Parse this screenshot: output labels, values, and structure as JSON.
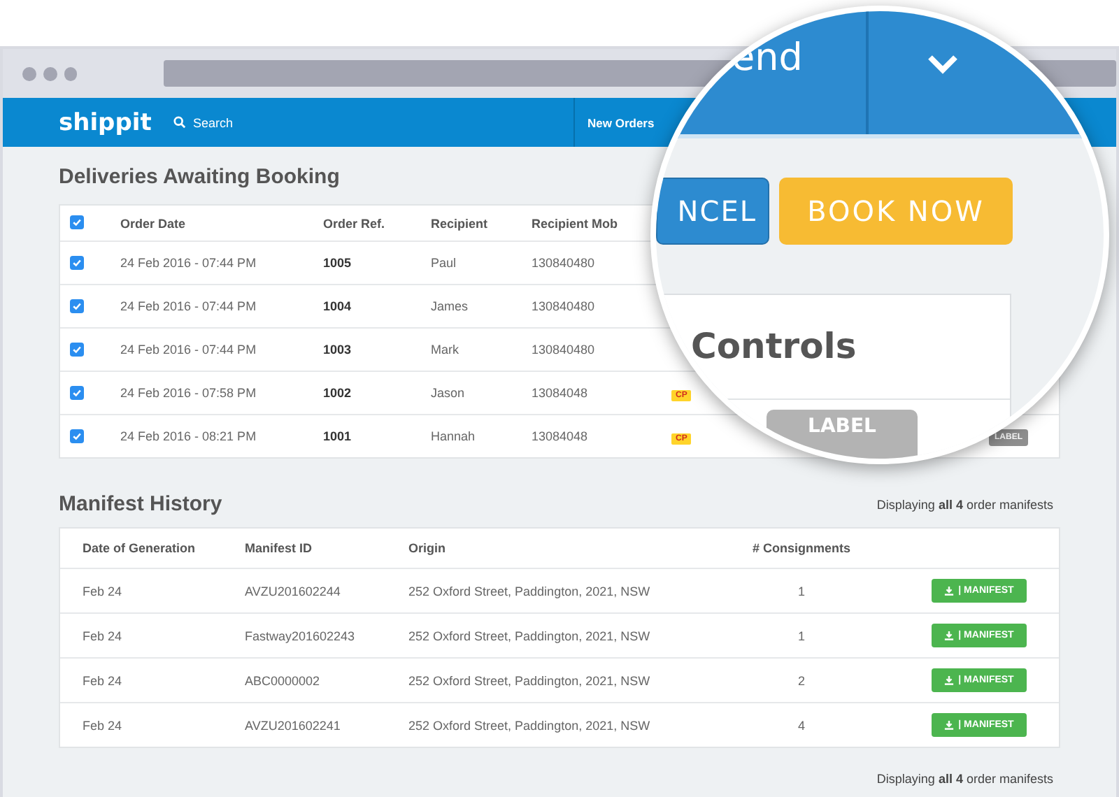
{
  "navbar": {
    "logo": "shippit",
    "search": "Search",
    "items": [
      "New Orders"
    ]
  },
  "awaiting": {
    "title": "Deliveries Awaiting Booking",
    "select_all_checked": true,
    "columns": [
      "Order Date",
      "Order Ref.",
      "Recipient",
      "Recipient Mob"
    ],
    "rows": [
      {
        "checked": true,
        "date": "24 Feb 2016 - 07:44 PM",
        "ref": "1005",
        "recipient": "Paul",
        "mobile": "130840480"
      },
      {
        "checked": true,
        "date": "24 Feb 2016 - 07:44 PM",
        "ref": "1004",
        "recipient": "James",
        "mobile": "130840480"
      },
      {
        "checked": true,
        "date": "24 Feb 2016 - 07:44 PM",
        "ref": "1003",
        "recipient": "Mark",
        "mobile": "130840480"
      },
      {
        "checked": true,
        "date": "24 Feb 2016 - 07:58 PM",
        "ref": "1002",
        "recipient": "Jason",
        "mobile": "13084048",
        "badge": "CP"
      },
      {
        "checked": true,
        "date": "24 Feb 2016 - 08:21 PM",
        "ref": "1001",
        "recipient": "Hannah",
        "mobile": "13084048",
        "badge": "CP",
        "action": "LABEL"
      }
    ]
  },
  "manifest_history": {
    "title": "Manifest History",
    "summary": "Displaying **all 4** order manifests",
    "columns": [
      "Date of Generation",
      "Manifest ID",
      "Origin",
      "# Consignments"
    ],
    "rows": [
      {
        "date": "Feb 24",
        "id": "AVZU201602244",
        "origin": "252 Oxford Street, Paddington, 2021, NSW",
        "consignments": "1",
        "button": "| MANIFEST"
      },
      {
        "date": "Feb 24",
        "id": "Fastway201602243",
        "origin": "252 Oxford Street, Paddington, 2021, NSW",
        "consignments": "1",
        "button": "| MANIFEST"
      },
      {
        "date": "Feb 24",
        "id": "ABC0000002",
        "origin": "252 Oxford Street, Paddington, 2021, NSW",
        "consignments": "2",
        "button": "| MANIFEST"
      },
      {
        "date": "Feb 24",
        "id": "AVZU201602241",
        "origin": "252 Oxford Street, Paddington, 2021, NSW",
        "consignments": "4",
        "button": "| MANIFEST"
      }
    ],
    "footer_summary": "Displaying **all 4** order manifests"
  },
  "magnifier": {
    "header_text": "end",
    "cancel_button": "NCEL",
    "book_button": "BOOK NOW",
    "card_title": "Controls",
    "label_button": "LABEL"
  }
}
